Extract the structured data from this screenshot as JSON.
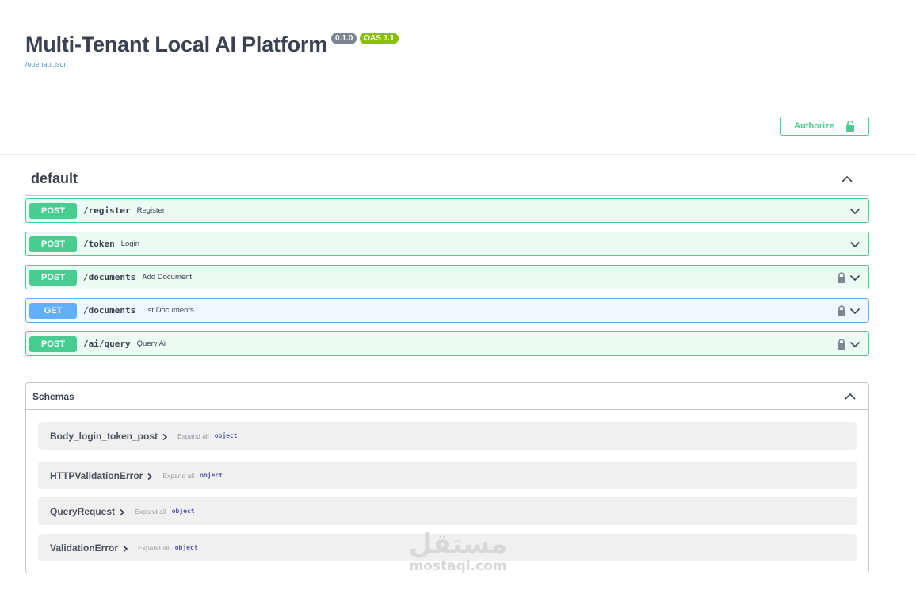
{
  "info": {
    "title": "Multi-Tenant Local AI Platform",
    "version": "0.1.0",
    "oas": "OAS 3.1",
    "spec_link": "/openapi.json"
  },
  "authorize": {
    "label": "Authorize",
    "icon": "unlock-icon",
    "color": "#49cc90"
  },
  "tag": {
    "name": "default",
    "toggle_icon": "chevron-up-icon"
  },
  "operations": [
    {
      "method": "POST",
      "path": "/register",
      "summary": "Register",
      "locked": false
    },
    {
      "method": "POST",
      "path": "/token",
      "summary": "Login",
      "locked": false
    },
    {
      "method": "POST",
      "path": "/documents",
      "summary": "Add Document",
      "locked": true
    },
    {
      "method": "GET",
      "path": "/documents",
      "summary": "List Documents",
      "locked": true
    },
    {
      "method": "POST",
      "path": "/ai/query",
      "summary": "Query Ai",
      "locked": true
    }
  ],
  "schemas": {
    "title": "Schemas",
    "items": [
      {
        "name": "Body_login_token_post",
        "expand": "Expand all",
        "type": "object"
      },
      {
        "name": "HTTPValidationError",
        "expand": "Expand all",
        "type": "object"
      },
      {
        "name": "QueryRequest",
        "expand": "Expand all",
        "type": "object"
      },
      {
        "name": "ValidationError",
        "expand": "Expand all",
        "type": "object"
      }
    ]
  },
  "watermark": {
    "arabic": "مستقل",
    "latin": "mostaql.com"
  },
  "colors": {
    "post": "#49cc90",
    "get": "#61affe",
    "text": "#3b4151"
  }
}
